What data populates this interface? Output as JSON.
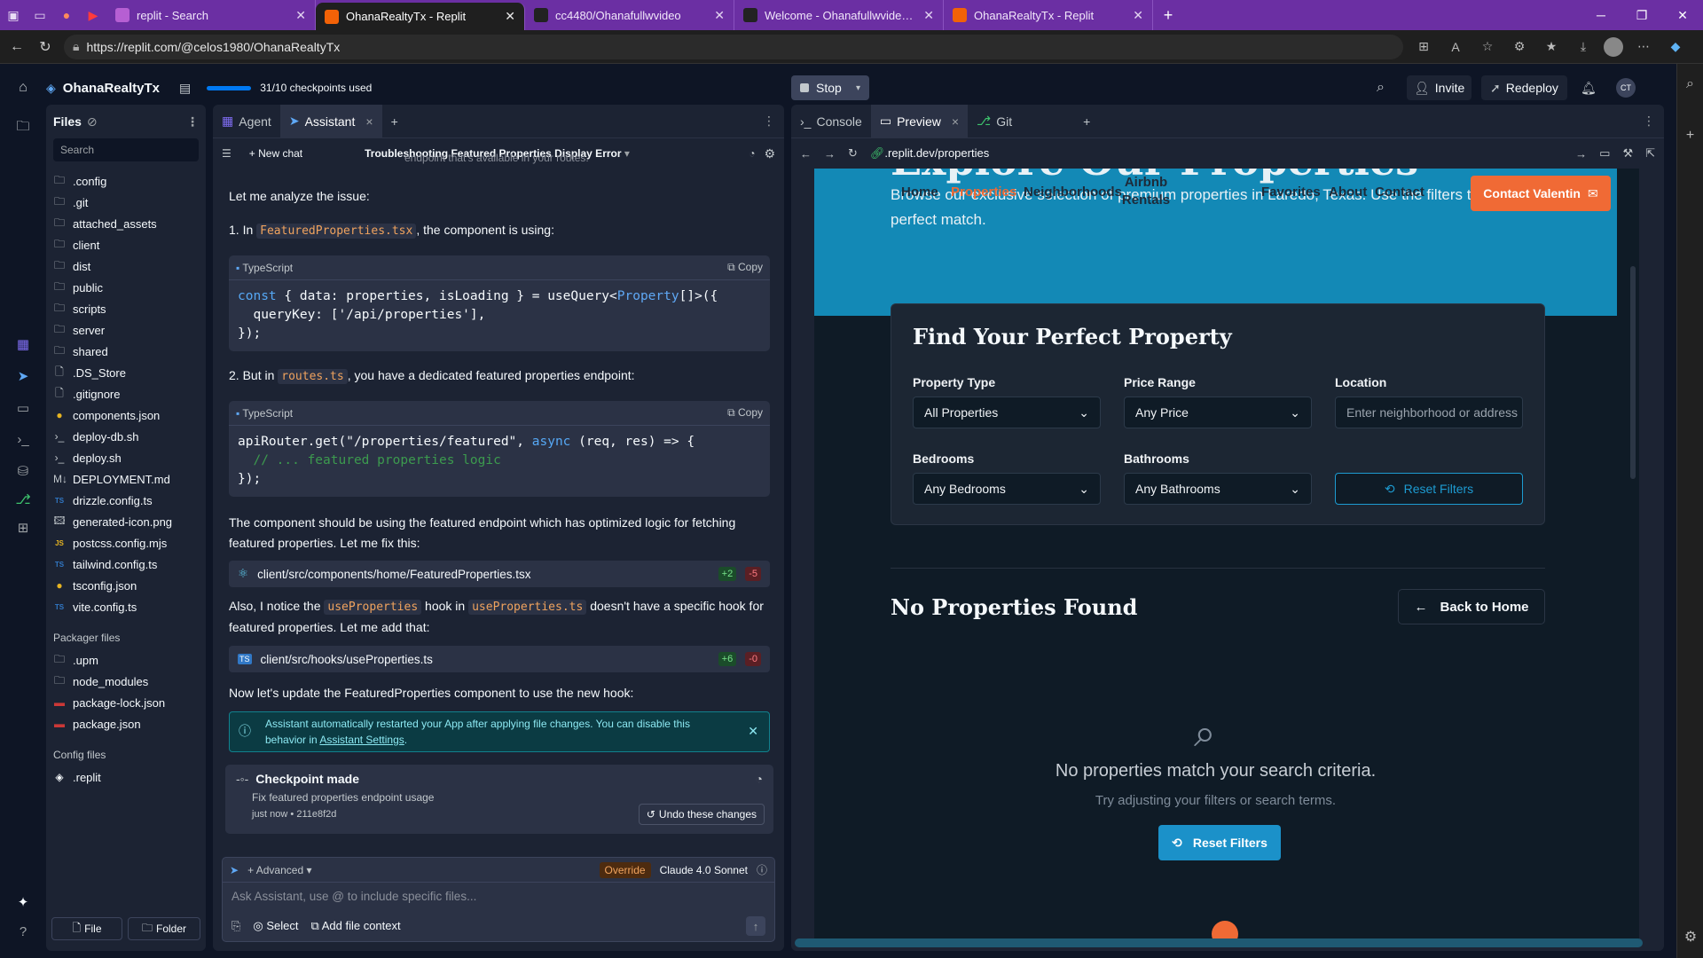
{
  "browser": {
    "tabs": [
      {
        "title": "replit - Search",
        "color": "#b65fd3"
      },
      {
        "title": "OhanaRealtyTx - Replit",
        "color": "#f26207",
        "active": true
      },
      {
        "title": "cc4480/Ohanafullwvideo",
        "color": "#222222"
      },
      {
        "title": "Welcome - Ohanafullwvideo [Cod",
        "color": "#222222"
      },
      {
        "title": "OhanaRealtyTx - Replit",
        "color": "#f26207"
      }
    ],
    "url": "https://replit.com/@celos1980/OhanaRealtyTx"
  },
  "header": {
    "project": "OhanaRealtyTx",
    "checkpoints": "31/10 checkpoints used",
    "stop": "Stop",
    "invite": "Invite",
    "redeploy": "Redeploy",
    "avatar": "CT"
  },
  "files": {
    "title": "Files",
    "search_placeholder": "Search",
    "items": [
      {
        "icon": "folder",
        "name": ".config"
      },
      {
        "icon": "folder",
        "name": ".git"
      },
      {
        "icon": "folder",
        "name": "attached_assets"
      },
      {
        "icon": "folder",
        "name": "client"
      },
      {
        "icon": "folder",
        "name": "dist"
      },
      {
        "icon": "folder",
        "name": "public"
      },
      {
        "icon": "folder",
        "name": "scripts"
      },
      {
        "icon": "folder",
        "name": "server"
      },
      {
        "icon": "folder",
        "name": "shared"
      },
      {
        "icon": "file",
        "name": ".DS_Store"
      },
      {
        "icon": "file",
        "name": ".gitignore"
      },
      {
        "icon": "json",
        "name": "components.json"
      },
      {
        "icon": "shell",
        "name": "deploy-db.sh"
      },
      {
        "icon": "shell",
        "name": "deploy.sh"
      },
      {
        "icon": "md",
        "name": "DEPLOYMENT.md"
      },
      {
        "icon": "ts",
        "name": "drizzle.config.ts"
      },
      {
        "icon": "img",
        "name": "generated-icon.png"
      },
      {
        "icon": "mjs",
        "name": "postcss.config.mjs"
      },
      {
        "icon": "ts",
        "name": "tailwind.config.ts"
      },
      {
        "icon": "json",
        "name": "tsconfig.json"
      },
      {
        "icon": "ts",
        "name": "vite.config.ts"
      }
    ],
    "packager_title": "Packager files",
    "packager": [
      {
        "icon": "folder",
        "name": ".upm"
      },
      {
        "icon": "folder",
        "name": "node_modules"
      },
      {
        "icon": "npm",
        "name": "package-lock.json"
      },
      {
        "icon": "npm",
        "name": "package.json"
      }
    ],
    "config_title": "Config files",
    "config": [
      {
        "icon": "replit",
        "name": ".replit"
      }
    ],
    "file_btn": "File",
    "folder_btn": "Folder"
  },
  "chat": {
    "tab_agent": "Agent",
    "tab_assistant": "Assistant",
    "new_chat": "New chat",
    "thread_title": "Troubleshooting Featured Properties Display Error",
    "top_partial": "endpoint that's available in your routes.",
    "p1": "Let me analyze the issue:",
    "p2_pre": "1. In ",
    "p2_code": "FeaturedProperties.tsx",
    "p2_post": ", the component is using:",
    "code1_lang": "TypeScript",
    "copy": "Copy",
    "p3_pre": "2. But in ",
    "p3_code": "routes.ts",
    "p3_post": ", you have a dedicated featured properties endpoint:",
    "code2_lang": "TypeScript",
    "p4": "The component should be using the featured endpoint which has optimized logic for fetching featured properties. Let me fix this:",
    "file1": "client/src/components/home/FeaturedProperties.tsx",
    "file1_add": "+2",
    "file1_del": "-5",
    "p5_a": "Also, I notice the ",
    "p5_code1": "useProperties",
    "p5_b": " hook in ",
    "p5_code2": "useProperties.ts",
    "p5_c": " doesn't have a specific hook for featured properties. Let me add that:",
    "file2": "client/src/hooks/useProperties.ts",
    "file2_add": "+6",
    "file2_del": "-0",
    "p6": "Now let's update the FeaturedProperties component to use the new hook:",
    "notice": "Assistant automatically restarted your App after applying file changes. You can disable this behavior in ",
    "notice_link": "Assistant Settings",
    "checkpoint_title": "Checkpoint made",
    "checkpoint_desc": "Fix featured properties endpoint usage",
    "checkpoint_time": "just now",
    "checkpoint_hash": "211e8f2d",
    "undo": "Undo these changes",
    "advanced": "Advanced",
    "override": "Override",
    "model": "Claude 4.0 Sonnet",
    "input_placeholder": "Ask Assistant, use @ to include specific files...",
    "select": "Select",
    "add_context": "Add file context"
  },
  "preview": {
    "tab_console": "Console",
    "tab_preview": "Preview",
    "tab_git": "Git",
    "url": ".replit.dev/properties",
    "hero_title": "Explore Our Properties",
    "hero_sub": "Browse our exclusive selection of premium properties in Laredo, Texas. Use the filters to find your perfect match.",
    "nav": [
      "Home",
      "Properties",
      "Neighborhoods",
      "Airbnb Rentals",
      "Favorites",
      "About",
      "Contact"
    ],
    "contact_btn": "Contact Valentin",
    "find_title": "Find Your Perfect Property",
    "label_type": "Property Type",
    "label_price": "Price Range",
    "label_location": "Location",
    "label_bed": "Bedrooms",
    "label_bath": "Bathrooms",
    "val_type": "All Properties",
    "val_price": "Any Price",
    "location_placeholder": "Enter neighborhood or address",
    "val_bed": "Any Bedrooms",
    "val_bath": "Any Bathrooms",
    "reset": "Reset Filters",
    "no_props": "No Properties Found",
    "back_home": "Back to Home",
    "empty_msg": "No properties match your search criteria.",
    "empty_hint": "Try adjusting your filters or search terms.",
    "reset_btn": "Reset Filters"
  }
}
